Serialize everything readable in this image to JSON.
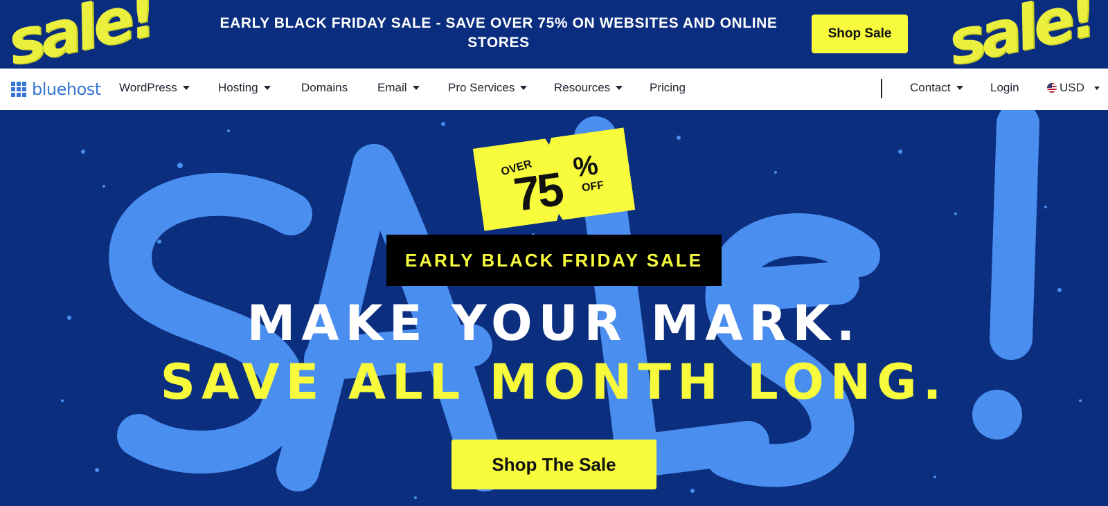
{
  "promo": {
    "text_regular_1": "EARLY BLACK FRIDAY SALE - ",
    "text_bold": "SAVE OVER 75%",
    "text_regular_2": " ON WEBSITES AND ONLINE STORES",
    "button_label": "Shop Sale",
    "graffiti_text": "sale!"
  },
  "nav": {
    "logo_text": "bluehost",
    "items": [
      {
        "label": "WordPress",
        "has_dropdown": true
      },
      {
        "label": "Hosting",
        "has_dropdown": true
      },
      {
        "label": "Domains",
        "has_dropdown": false
      },
      {
        "label": "Email",
        "has_dropdown": true
      },
      {
        "label": "Pro Services",
        "has_dropdown": true
      },
      {
        "label": "Resources",
        "has_dropdown": true
      },
      {
        "label": "Pricing",
        "has_dropdown": false
      }
    ],
    "contact_label": "Contact",
    "login_label": "Login",
    "currency_label": "USD"
  },
  "hero": {
    "ticket_over": "OVER",
    "ticket_number": "75",
    "ticket_percent": "%",
    "ticket_off": "OFF",
    "badge_text": "EARLY BLACK FRIDAY SALE",
    "headline_1": "MAKE YOUR MARK.",
    "headline_2": "SAVE ALL MONTH LONG.",
    "cta_label": "Shop The Sale"
  },
  "colors": {
    "banner_bg": "#0b2d80",
    "hero_bg": "#0b2e7e",
    "accent_yellow": "#f7fb3c",
    "spray_blue": "#4a8ef0",
    "logo_blue": "#3575d3"
  }
}
